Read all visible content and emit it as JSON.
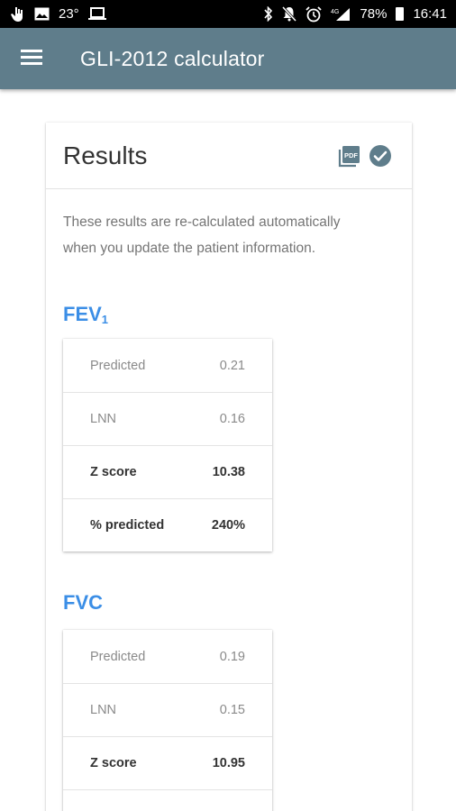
{
  "status_bar": {
    "temperature": "23°",
    "battery": "78%",
    "time": "16:41"
  },
  "app_bar": {
    "title": "GLI-2012 calculator"
  },
  "card": {
    "title": "Results",
    "intro_line1": "These results are re-calculated automatically",
    "intro_line2": "when you update the patient information."
  },
  "fev1": {
    "title": "FEV",
    "title_sub": "1",
    "rows": [
      {
        "label": "Predicted",
        "value": "0.21"
      },
      {
        "label": "LNN",
        "value": "0.16"
      },
      {
        "label": "Z score",
        "value": "10.38"
      },
      {
        "label": "% predicted",
        "value": "240%"
      }
    ]
  },
  "fvc": {
    "title": "FVC",
    "rows": [
      {
        "label": "Predicted",
        "value": "0.19"
      },
      {
        "label": "LNN",
        "value": "0.15"
      },
      {
        "label": "Z score",
        "value": "10.95"
      }
    ]
  },
  "icons": {
    "pdf": "pdf-icon",
    "check": "check-circle-icon",
    "menu": "hamburger-menu-icon"
  },
  "colors": {
    "app_bar": "#5f7d8b",
    "section_title": "#3b8ee6"
  }
}
